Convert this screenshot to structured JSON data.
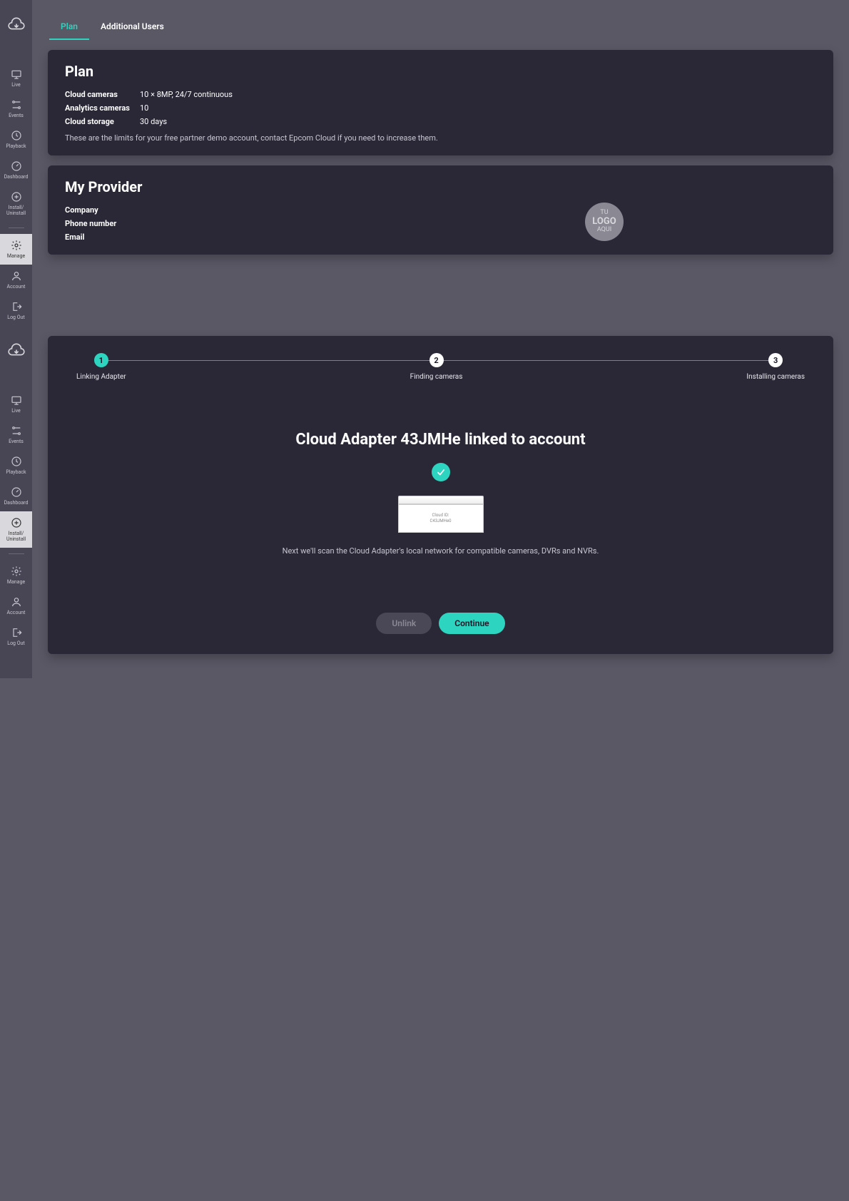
{
  "sidebar1": {
    "items": [
      {
        "label": "Live"
      },
      {
        "label": "Events"
      },
      {
        "label": "Playback"
      },
      {
        "label": "Dashboard"
      },
      {
        "label": "Install/\nUninstall"
      }
    ],
    "bottom": [
      {
        "label": "Manage"
      },
      {
        "label": "Account"
      },
      {
        "label": "Log Out"
      }
    ]
  },
  "sidebar2": {
    "items": [
      {
        "label": "Live"
      },
      {
        "label": "Events"
      },
      {
        "label": "Playback"
      },
      {
        "label": "Dashboard"
      },
      {
        "label": "Install/\nUninstall"
      }
    ],
    "bottom": [
      {
        "label": "Manage"
      },
      {
        "label": "Account"
      },
      {
        "label": "Log Out"
      }
    ]
  },
  "tabs": {
    "plan": "Plan",
    "additional_users": "Additional Users"
  },
  "plan": {
    "title": "Plan",
    "rows": [
      {
        "label": "Cloud cameras",
        "value": "10 × 8MP, 24/7 continuous"
      },
      {
        "label": "Analytics cameras",
        "value": "10"
      },
      {
        "label": "Cloud storage",
        "value": "30 days"
      }
    ],
    "note": "These are the limits for your free partner demo account, contact Epcom Cloud if you need to increase them."
  },
  "provider": {
    "title": "My Provider",
    "fields": {
      "company": "Company",
      "phone": "Phone number",
      "email": "Email"
    },
    "logo_text": {
      "top": "TU",
      "mid": "LOGO",
      "bot": "AQUI"
    }
  },
  "stepper": {
    "steps": [
      {
        "num": "1",
        "label": "Linking Adapter"
      },
      {
        "num": "2",
        "label": "Finding cameras"
      },
      {
        "num": "3",
        "label": "Installing cameras"
      }
    ]
  },
  "linked": {
    "title": "Cloud Adapter 43JMHe linked to account",
    "device_label1": "Cloud ID:",
    "device_label2": "C43JMHe0",
    "note": "Next we'll scan the Cloud Adapter's local network for compatible cameras, DVRs and NVRs.",
    "unlink": "Unlink",
    "continue": "Continue"
  }
}
